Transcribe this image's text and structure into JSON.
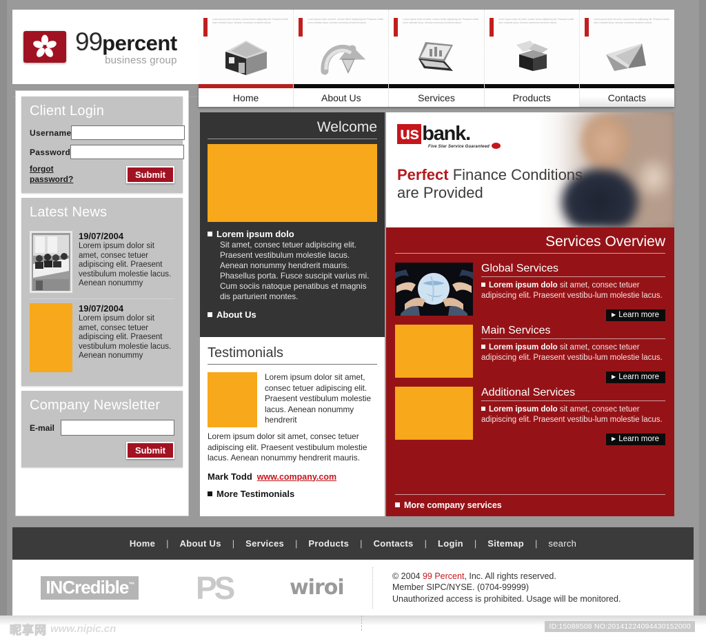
{
  "brand": {
    "logo_icon": "flower-pinwheel-icon",
    "name_primary": "99",
    "name_secondary": "percent",
    "tagline": "business group"
  },
  "icon_strip": {
    "micro_text": "Lorem ipsum dolor sit amet, consec tetuer adipiscing elit. Praesent vestibulum molestie lacus. Aenean nonummy hendrerit mauris.",
    "items": [
      {
        "icon": "house-3d-icon",
        "glyph": "⌂"
      },
      {
        "icon": "curved-arrow-3d-icon",
        "glyph": "↷"
      },
      {
        "icon": "laptop-3d-icon",
        "glyph": "💻"
      },
      {
        "icon": "open-box-3d-icon",
        "glyph": "📦"
      },
      {
        "icon": "paper-plane-3d-icon",
        "glyph": "✈"
      }
    ]
  },
  "main_nav": {
    "items": [
      {
        "label": "Home",
        "active": true
      },
      {
        "label": "About Us",
        "active": false
      },
      {
        "label": "Services",
        "active": false
      },
      {
        "label": "Products",
        "active": false
      },
      {
        "label": "Contacts",
        "active": false
      }
    ]
  },
  "sidebar": {
    "login": {
      "title": "Client Login",
      "username_label": "Username",
      "username_value": "",
      "password_label": "Password",
      "password_value": "",
      "forgot_label": "forgot password?",
      "submit_label": "Submit"
    },
    "news": {
      "title": "Latest News",
      "items": [
        {
          "date": "19/07/2004",
          "text": "Lorem ipsum dolor sit amet, consec tetuer adipiscing elit. Praesent vestibulum molestie lacus. Aenean nonummy",
          "thumb": "meeting-room-photo"
        },
        {
          "date": "19/07/2004",
          "text": "Lorem ipsum dolor sit amet, consec tetuer adipiscing elit. Praesent vestibulum molestie lacus. Aenean nonummy",
          "thumb": "orange-placeholder"
        }
      ]
    },
    "newsletter": {
      "title": "Company Newsletter",
      "email_label": "E-mail",
      "email_value": "",
      "submit_label": "Submit"
    }
  },
  "center": {
    "welcome": {
      "title": "Welcome",
      "image": "orange-placeholder",
      "heading": "Lorem ipsum dolo",
      "body": "Sit amet, consec tetuer adipiscing elit. Praesent vestibulum molestie lacus. Aenean nonummy hendrerit mauris. Phasellus porta. Fusce suscipit varius mi. Cum sociis natoque penatibus et magnis dis parturient montes.",
      "link_label": "About Us"
    },
    "testimonials": {
      "title": "Testimonials",
      "image": "orange-placeholder",
      "quote": "Lorem ipsum dolor sit amet, consec tetuer adipiscing elit. Praesent vestibulum molestie lacus. Aenean nonummy hendrerit",
      "body": "Lorem ipsum dolor sit amet, consec tetuer adipiscing elit. Praesent vestibulum molestie lacus. Aenean nonummy hendrerit mauris.",
      "author": "Mark Todd",
      "author_link": "www.company.com",
      "more_label": "More Testimonials"
    }
  },
  "banner": {
    "logo_us": "us",
    "logo_bank": "bank.",
    "logo_tagline": "Five Star Service Guaranteed",
    "headline_accent": "Perfect",
    "headline_rest": " Finance Conditions",
    "headline_line2": "are Provided",
    "photo": "blurred-businessperson-photo"
  },
  "services": {
    "title": "Services Overview",
    "more_label": "More company services",
    "items": [
      {
        "heading": "Global Services",
        "lead": "Lorem ipsum dolo",
        "body": " sit amet, consec tetuer adipiscing elit. Praesent vestibu-lum molestie lacus.",
        "cta": "Learn more",
        "image": "hands-around-globe-photo"
      },
      {
        "heading": "Main Services",
        "lead": "Lorem ipsum dolo",
        "body": " sit amet, consec tetuer adipiscing elit. Praesent vestibu-lum molestie lacus.",
        "cta": "Learn more",
        "image": "orange-placeholder"
      },
      {
        "heading": "Additional Services",
        "lead": "Lorem ipsum dolo",
        "body": " sit amet, consec tetuer adipiscing elit. Praesent vestibu-lum molestie lacus.",
        "cta": "Learn more",
        "image": "orange-placeholder"
      }
    ]
  },
  "footer_nav": {
    "items": [
      "Home",
      "About Us",
      "Services",
      "Products",
      "Contacts",
      "Login",
      "Sitemap",
      "search"
    ],
    "separator": "|"
  },
  "footer": {
    "partners": [
      {
        "name": "INCredible",
        "tm": "™"
      },
      {
        "name": "PS"
      },
      {
        "name": "wiroi"
      }
    ],
    "copyright_pre": "© 2004 ",
    "copyright_brand": "99 Percent",
    "copyright_post": ", Inc. All rights reserved.",
    "line2": "Member SIPC/NYSE. (0704-99999)",
    "line3": "Unauthorized access is prohibited. Usage will be monitored."
  },
  "watermark": {
    "cn_text": "昵享网",
    "url": "www.nipic.cn",
    "id_text": "ID:15088508 NO:20141224094430152000"
  },
  "colors": {
    "brand_red": "#a01222",
    "accent_red": "#c4161c",
    "services_bg": "#951317",
    "dark_panel": "#343434",
    "orange": "#f7a81b",
    "page_bg": "#8e8e8e"
  }
}
